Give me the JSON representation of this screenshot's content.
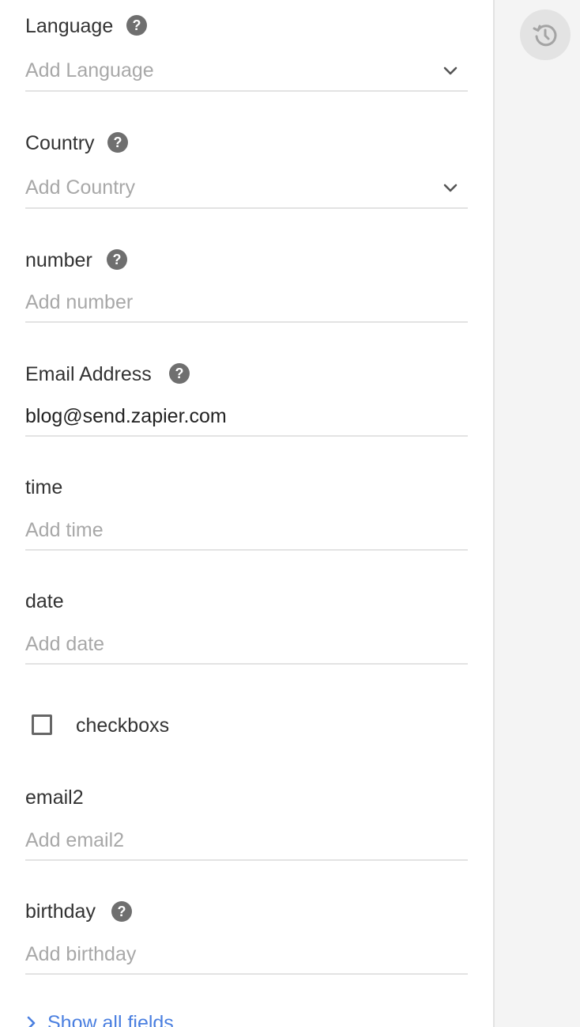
{
  "fields": {
    "language": {
      "label": "Language",
      "placeholder": "Add Language"
    },
    "country": {
      "label": "Country",
      "placeholder": "Add Country"
    },
    "number": {
      "label": "number",
      "placeholder": "Add number"
    },
    "email_address": {
      "label": "Email Address",
      "value": "blog@send.zapier.com"
    },
    "time": {
      "label": "time",
      "placeholder": "Add time"
    },
    "date": {
      "label": "date",
      "placeholder": "Add date"
    },
    "checkboxs": {
      "label": "checkboxs",
      "checked": false
    },
    "email2": {
      "label": "email2",
      "placeholder": "Add email2"
    },
    "birthday": {
      "label": "birthday",
      "placeholder": "Add birthday"
    }
  },
  "help_glyph": "?",
  "show_all_fields": "Show all fields",
  "icons": {
    "help": "question-circle-icon",
    "dropdown": "chevron-down-icon",
    "reset": "history-icon",
    "expand": "chevron-right-icon"
  },
  "colors": {
    "link": "#4a7fe0",
    "help_icon_bg": "#6f6f6f",
    "rail_bg": "#f4f4f4"
  }
}
